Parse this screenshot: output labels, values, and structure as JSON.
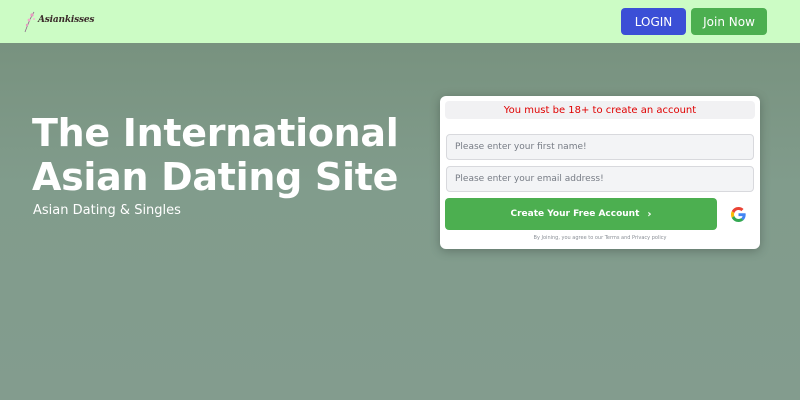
{
  "header": {
    "logo_text": "Asiankisses",
    "login_label": "LOGIN",
    "join_label": "Join Now"
  },
  "hero": {
    "title": "The International Asian Dating Site",
    "subtitle": "Asian Dating & Singles"
  },
  "signup": {
    "age_notice": "You must be 18+ to create an account",
    "first_name_placeholder": "Please enter your first name!",
    "email_placeholder": "Please enter your email address!",
    "create_label": "Create Your Free Account",
    "create_chevron": "›",
    "google_icon": "google-icon",
    "terms_text": "By Joining, you agree to our Terms and Privacy policy"
  },
  "colors": {
    "header_bg": "#ccfcc5",
    "login_bg": "#3b4fd6",
    "accent_green": "#4caf50",
    "notice_red": "#e00000",
    "hero_bg": "#7f9a8b"
  }
}
